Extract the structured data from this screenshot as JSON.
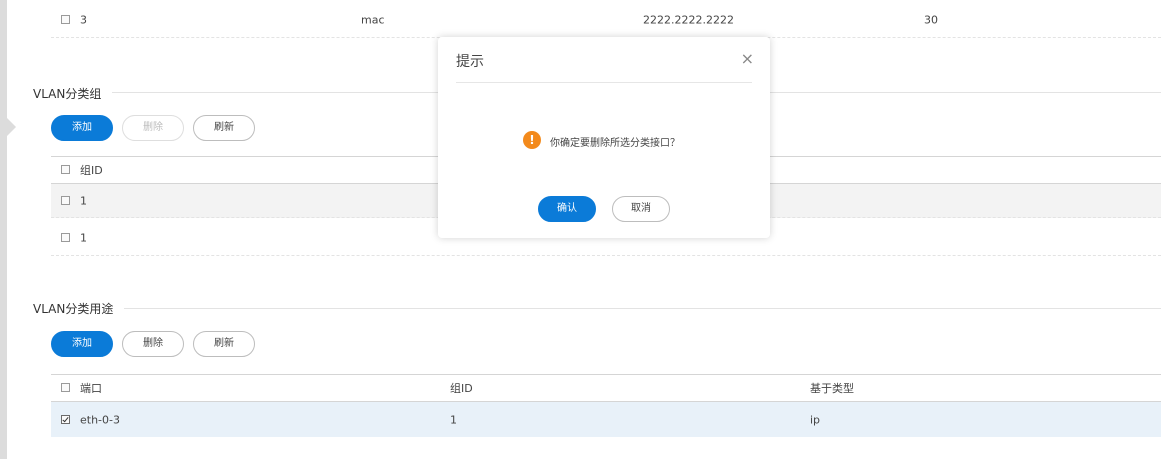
{
  "top_table": {
    "row": {
      "id": "3",
      "type": "mac",
      "mac": "2222.2222.2222",
      "vlan": "30"
    }
  },
  "group_section": {
    "title": "VLAN分类组",
    "add_label": "添加",
    "delete_label": "删除",
    "refresh_label": "刷新",
    "columns": [
      "组ID"
    ],
    "rows": [
      {
        "id": "1",
        "checked": false
      },
      {
        "id": "1",
        "checked": false
      }
    ]
  },
  "usage_section": {
    "title": "VLAN分类用途",
    "add_label": "添加",
    "delete_label": "删除",
    "refresh_label": "刷新",
    "columns": [
      "端口",
      "组ID",
      "基于类型"
    ],
    "rows": [
      {
        "port": "eth-0-3",
        "group_id": "1",
        "type": "ip",
        "checked": true
      }
    ]
  },
  "dialog": {
    "title": "提示",
    "close_icon": "×",
    "warning_icon": "!",
    "message": "你确定要删除所选分类接口？",
    "confirm_label": "确认",
    "cancel_label": "取消"
  },
  "colors": {
    "primary": "#0b7bd8",
    "warning": "#f38a1c",
    "selected_row": "#e8f1f9"
  }
}
